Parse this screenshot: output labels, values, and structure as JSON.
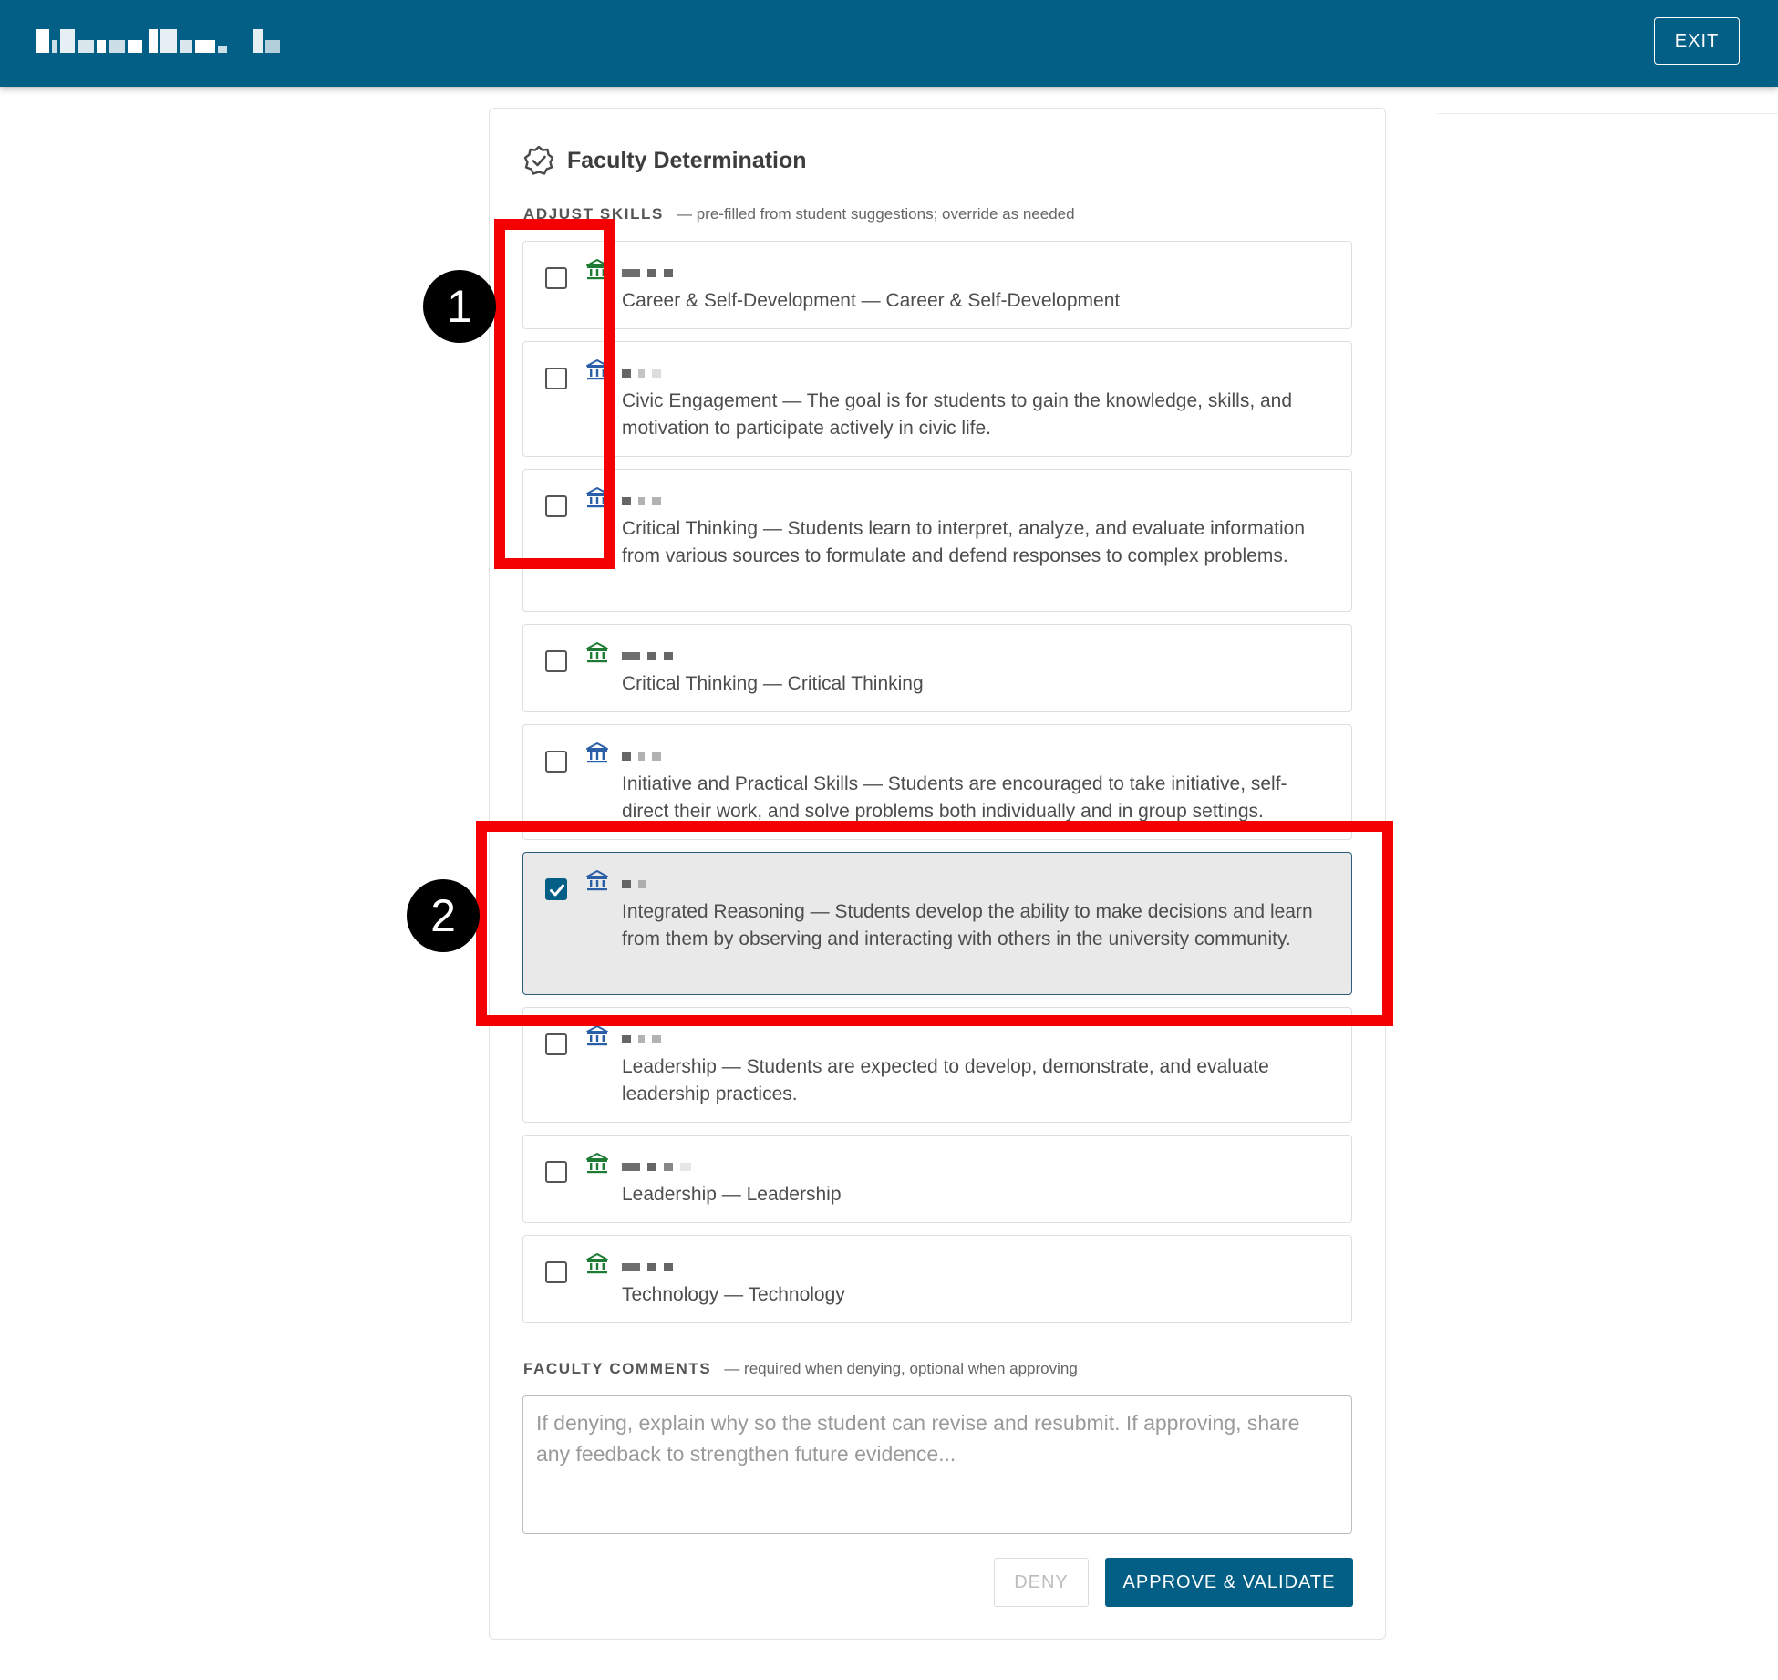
{
  "header": {
    "exit_label": "EXIT"
  },
  "card": {
    "title": "Faculty Determination",
    "skills_section": {
      "label": "ADJUST SKILLS",
      "hint": "— pre-filled from student suggestions; override as needed"
    },
    "skills": [
      {
        "text": "Career & Self-Development — Career & Self-Development",
        "checked": false,
        "icon_color": "#1e7b34",
        "icon": "institution-icon"
      },
      {
        "text": "Civic Engagement — The goal is for students to gain the knowledge, skills, and motivation to participate actively in civic life.",
        "checked": false,
        "icon_color": "#2a5fa8",
        "icon": "institution-icon"
      },
      {
        "text": "Critical Thinking — Students learn to interpret, analyze, and evaluate information from various sources to formulate and defend responses to complex problems.",
        "checked": false,
        "icon_color": "#2a5fa8",
        "icon": "institution-icon"
      },
      {
        "text": "Critical Thinking — Critical Thinking",
        "checked": false,
        "icon_color": "#1e7b34",
        "icon": "institution-icon"
      },
      {
        "text": "Initiative and Practical Skills — Students are encouraged to take initiative, self-direct their work, and solve problems both individually and in group settings.",
        "checked": false,
        "icon_color": "#2a5fa8",
        "icon": "institution-icon"
      },
      {
        "text": "Integrated Reasoning — Students develop the ability to make decisions and learn from them by observing and interacting with others in the university community.",
        "checked": true,
        "icon_color": "#2a5fa8",
        "icon": "institution-icon"
      },
      {
        "text": "Leadership — Students are expected to develop, demonstrate, and evaluate leadership practices.",
        "checked": false,
        "icon_color": "#2a5fa8",
        "icon": "institution-icon"
      },
      {
        "text": "Leadership — Leadership",
        "checked": false,
        "icon_color": "#1e7b34",
        "icon": "institution-icon"
      },
      {
        "text": "Technology — Technology",
        "checked": false,
        "icon_color": "#1e7b34",
        "icon": "institution-icon"
      }
    ],
    "comments_section": {
      "label": "FACULTY COMMENTS",
      "hint": "— required when denying, optional when approving",
      "placeholder": "If denying, explain why so the student can revise and resubmit. If approving, share any feedback to strengthen future evidence...",
      "value": ""
    },
    "actions": {
      "deny_label": "DENY",
      "approve_label": "APPROVE & VALIDATE"
    }
  },
  "annotations": [
    "1",
    "2"
  ],
  "colors": {
    "header_bg": "#035f86",
    "primary": "#035f86",
    "annotation": "#f40000"
  }
}
